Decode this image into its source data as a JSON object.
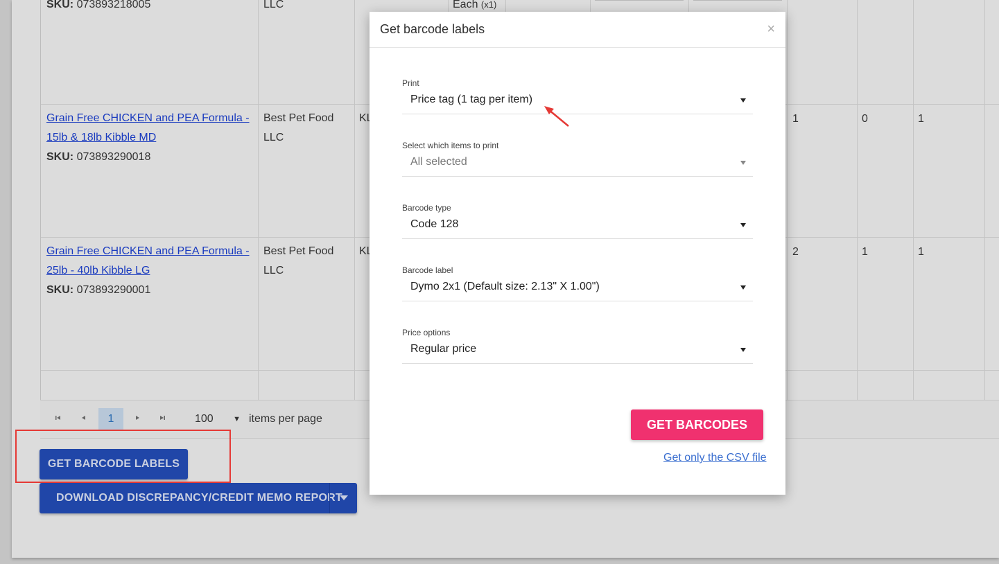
{
  "table": {
    "top_row": {
      "sku_label": "SKU:",
      "sku": "073893218005",
      "vendor_fragment": "LLC",
      "unit": "Each",
      "unit_qty": "(x1)"
    },
    "rows": [
      {
        "product_line1": "Grain Free CHICKEN and PEA Formula -",
        "product_line2": "15lb & 18lb Kibble MD",
        "sku_label": "SKU:",
        "sku": "073893290018",
        "vendor_line1": "Best Pet Food",
        "vendor_line2": "LLC",
        "code_fragment": "KL",
        "n1": "1",
        "n2": "0",
        "n3": "1"
      },
      {
        "product_line1": "Grain Free CHICKEN and PEA Formula -",
        "product_line2": "25lb - 40lb Kibble LG",
        "sku_label": "SKU:",
        "sku": "073893290001",
        "vendor_line1": "Best Pet Food",
        "vendor_line2": "LLC",
        "code_fragment": "KL",
        "n1": "2",
        "n2": "1",
        "n3": "1"
      }
    ]
  },
  "pager": {
    "current_page": "1",
    "per_page": "100",
    "per_page_label": "items per page",
    "first_icon": "first-page-icon",
    "prev_icon": "prev-page-icon",
    "next_icon": "next-page-icon",
    "last_icon": "last-page-icon"
  },
  "actions": {
    "get_barcode_labels": "GET BARCODE LABELS",
    "download_report": "DOWNLOAD DISCREPANCY/CREDIT MEMO REPORT"
  },
  "modal": {
    "title": "Get barcode labels",
    "close_icon": "close-icon",
    "fields": [
      {
        "label": "Print",
        "value": "Price tag (1 tag per item)"
      },
      {
        "label": "Select which items to print",
        "value": "All selected"
      },
      {
        "label": "Barcode type",
        "value": "Code 128"
      },
      {
        "label": "Barcode label",
        "value": "Dymo 2x1 (Default size: 2.13\" X 1.00\")"
      },
      {
        "label": "Price options",
        "value": "Regular price"
      }
    ],
    "get_barcodes_button": "GET BARCODES",
    "csv_link": "Get only the CSV file"
  },
  "colors": {
    "accent_pink": "#f0316f",
    "primary_blue": "#2046a8",
    "annotation_red": "#e53935",
    "link_blue": "#1a3bbf"
  }
}
